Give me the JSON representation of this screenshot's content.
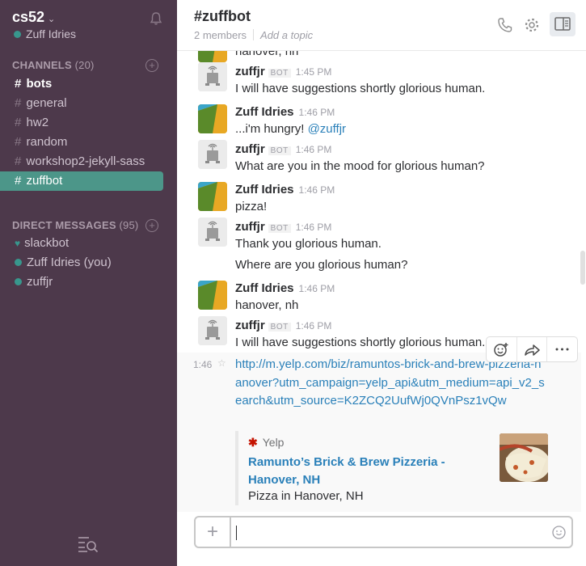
{
  "workspace": {
    "name": "cs52",
    "user": "Zuff Idries"
  },
  "channels": {
    "heading": "CHANNELS",
    "count": "(20)",
    "items": [
      {
        "label": "bots"
      },
      {
        "label": "general"
      },
      {
        "label": "hw2"
      },
      {
        "label": "random"
      },
      {
        "label": "workshop2-jekyll-sass"
      },
      {
        "label": "zuffbot"
      }
    ]
  },
  "direct_messages": {
    "heading": "DIRECT MESSAGES",
    "count": "(95)",
    "items": [
      {
        "label": "slackbot"
      },
      {
        "label": "Zuff Idries (you)"
      },
      {
        "label": "zuffjr"
      }
    ]
  },
  "header": {
    "title": "#zuffbot",
    "members": "2 members",
    "topic_placeholder": "Add a topic"
  },
  "messages": [
    {
      "body": "hanover, nh"
    },
    {
      "author": "zuffjr",
      "badge": "BOT",
      "time": "1:45 PM",
      "body": "I will have suggestions shortly glorious human."
    },
    {
      "author": "Zuff Idries",
      "time": "1:46 PM",
      "body": "...i'm hungry! ",
      "mention": "@zuffjr"
    },
    {
      "author": "zuffjr",
      "badge": "BOT",
      "time": "1:46 PM",
      "body": "What are you in the mood for glorious human?"
    },
    {
      "author": "Zuff Idries",
      "time": "1:46 PM",
      "body": "pizza!"
    },
    {
      "author": "zuffjr",
      "badge": "BOT",
      "time": "1:46 PM",
      "body": "Thank you glorious human.",
      "body2": "Where are you glorious human?"
    },
    {
      "author": "Zuff Idries",
      "time": "1:46 PM",
      "body": "hanover, nh"
    },
    {
      "author": "zuffjr",
      "badge": "BOT",
      "time": "1:46 PM",
      "body": "I will have suggestions shortly glorious human."
    }
  ],
  "followup": {
    "time": "1:46",
    "link": "http://m.yelp.com/biz/ramuntos-brick-and-brew-pizzeria-hanover?utm_campaign=yelp_api&utm_medium=api_v2_search&utm_source=K2ZCQ2UufWj0QVnPsz1vQw",
    "attachment": {
      "service": "Yelp",
      "title": "Ramunto’s Brick & Brew Pizzeria - Hanover, NH",
      "text": "Pizza in Hanover, NH"
    }
  },
  "composer": {
    "value": ""
  },
  "colors": {
    "sidebar": "#4d394b",
    "active_channel": "#4c9689",
    "presence": "#38978d",
    "link": "#2a80b9"
  }
}
